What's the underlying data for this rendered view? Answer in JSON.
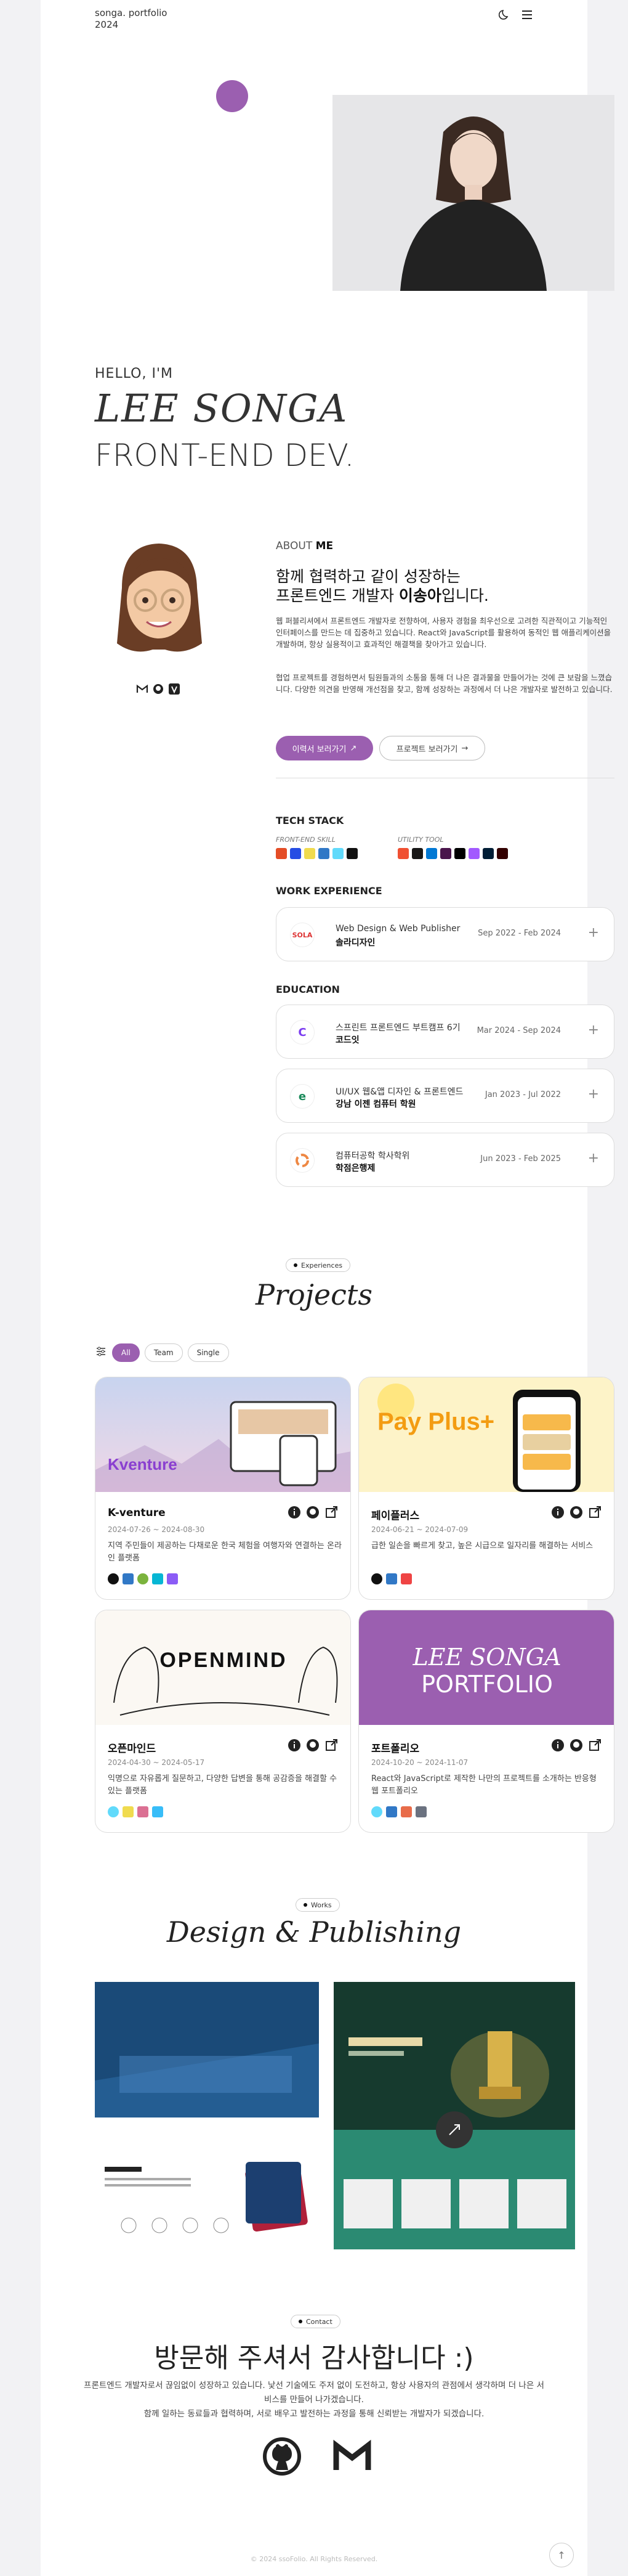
{
  "header": {
    "brand_line1": "songa. portfolio",
    "brand_line2": "2024",
    "theme_icon": "moon-icon",
    "menu_icon": "hamburger-menu-icon"
  },
  "hero": {
    "hello": "HELLO, I'M",
    "name": "LEE SONGA",
    "role": "FRONT-END DEV.",
    "accent_color": "#9b5fb0"
  },
  "about": {
    "heading_prefix": "ABOUT",
    "heading_bold": "ME",
    "title_line1": "함께 협력하고 같이 성장하는",
    "title_line2_prefix": "프론트엔드 개발자 ",
    "title_line2_bold": "이송아",
    "title_line2_suffix": "입니다.",
    "para1": "웹 퍼블리셔에서 프론트엔드 개발자로 전향하여, 사용자 경험을 최우선으로 고려한 직관적이고 기능적인 인터페이스를 만드는 데 집중하고 있습니다. React와 JavaScript를 활용하여 동적인 웹 애플리케이션을 개발하며, 항상 실용적이고 효과적인 해결책을 찾아가고 있습니다.",
    "para2": "협업 프로젝트를 경험하면서 팀원들과의 소통을 통해 더 나은 결과물을 만들어가는 것에 큰 보람을 느꼈습니다. 다양한 의견을 반영해 개선점을 찾고, 함께 성장하는 과정에서 더 나은 개발자로 발전하고 있습니다.",
    "btn_primary": "이력서 보러가기",
    "btn_secondary": "프로젝트 보러가기"
  },
  "skills": {
    "heading": "TECH STACK",
    "frontend_label": "FRONT-END SKILL",
    "tool_label": "UTILITY TOOL"
  },
  "experience": {
    "heading": "WORK EXPERIENCE",
    "items": [
      {
        "role": "Web Design & Web Publisher",
        "org": "솔라디자인",
        "date": "Sep 2022 - Feb 2024"
      }
    ]
  },
  "education": {
    "heading": "EDUCATION",
    "items": [
      {
        "course": "스프린트 프론트엔드 부트캠프 6기",
        "org": "코드잇",
        "date": "Mar 2024 - Sep 2024"
      },
      {
        "course": "UI/UX 웹&앱 디자인 & 프론트엔드",
        "org": "강남 이젠 컴퓨터 학원",
        "date": "Jan 2023 - Jul 2022"
      },
      {
        "course": "컴퓨터공학 학사학위",
        "org": "학점은행제",
        "date": "Jun 2023 - Feb 2025"
      }
    ]
  },
  "projects": {
    "pill": "Experiences",
    "title": "Projects",
    "filters": [
      "All",
      "Team",
      "Single"
    ],
    "items": [
      {
        "title": "K-venture",
        "date": "2024-07-26 ~ 2024-08-30",
        "desc": "지역 주민들이 제공하는 다채로운 한국 체험을 여행자와 연결하는 온라인 플랫폼"
      },
      {
        "title": "페이플러스",
        "date": "2024-06-21 ~ 2024-07-09",
        "desc": "급한 일손을 빠르게 찾고, 높은 시급으로 일자리를 해결하는 서비스"
      },
      {
        "title": "오픈마인드",
        "date": "2024-04-30 ~ 2024-05-17",
        "desc": "익명으로 자유롭게 질문하고, 다양한 답변을 통해 공감증을 해결할 수 있는 플랫폼"
      },
      {
        "title": "포트폴리오",
        "date": "2024-10-20 ~ 2024-11-07",
        "desc": "React와 JavaScript로 제작한 나만의 프로젝트를 소개하는 반응형 웹 포트폴리오"
      }
    ],
    "thumb_kventure": "Kventure",
    "thumb_payplus": "Pay Plus+",
    "thumb_openmind": "OPENMIND",
    "thumb_portfolio_line1": "LEE SONGA",
    "thumb_portfolio_line2": "PORTFOLIO"
  },
  "works": {
    "pill": "Works",
    "title": "Design & Publishing"
  },
  "contact": {
    "pill": "Contact",
    "title": "방문해 주셔서 감사합니다 :)",
    "line1": "프론트엔드 개발자로서 끊임없이 성장하고 있습니다. 낯선 기술에도 주저 없이 도전하고, 항상 사용자의 관점에서 생각하며 더 나은 서비스를 만들어 나가겠습니다.",
    "line2": "함께 일하는 동료들과 협력하며, 서로 배우고 발전하는 과정을 통해 신뢰받는 개발자가 되겠습니다.",
    "copyright": "© 2024 ssoFolio. All Rights Reserved.",
    "github_icon": "github-icon",
    "gmail_icon": "gmail-icon"
  }
}
